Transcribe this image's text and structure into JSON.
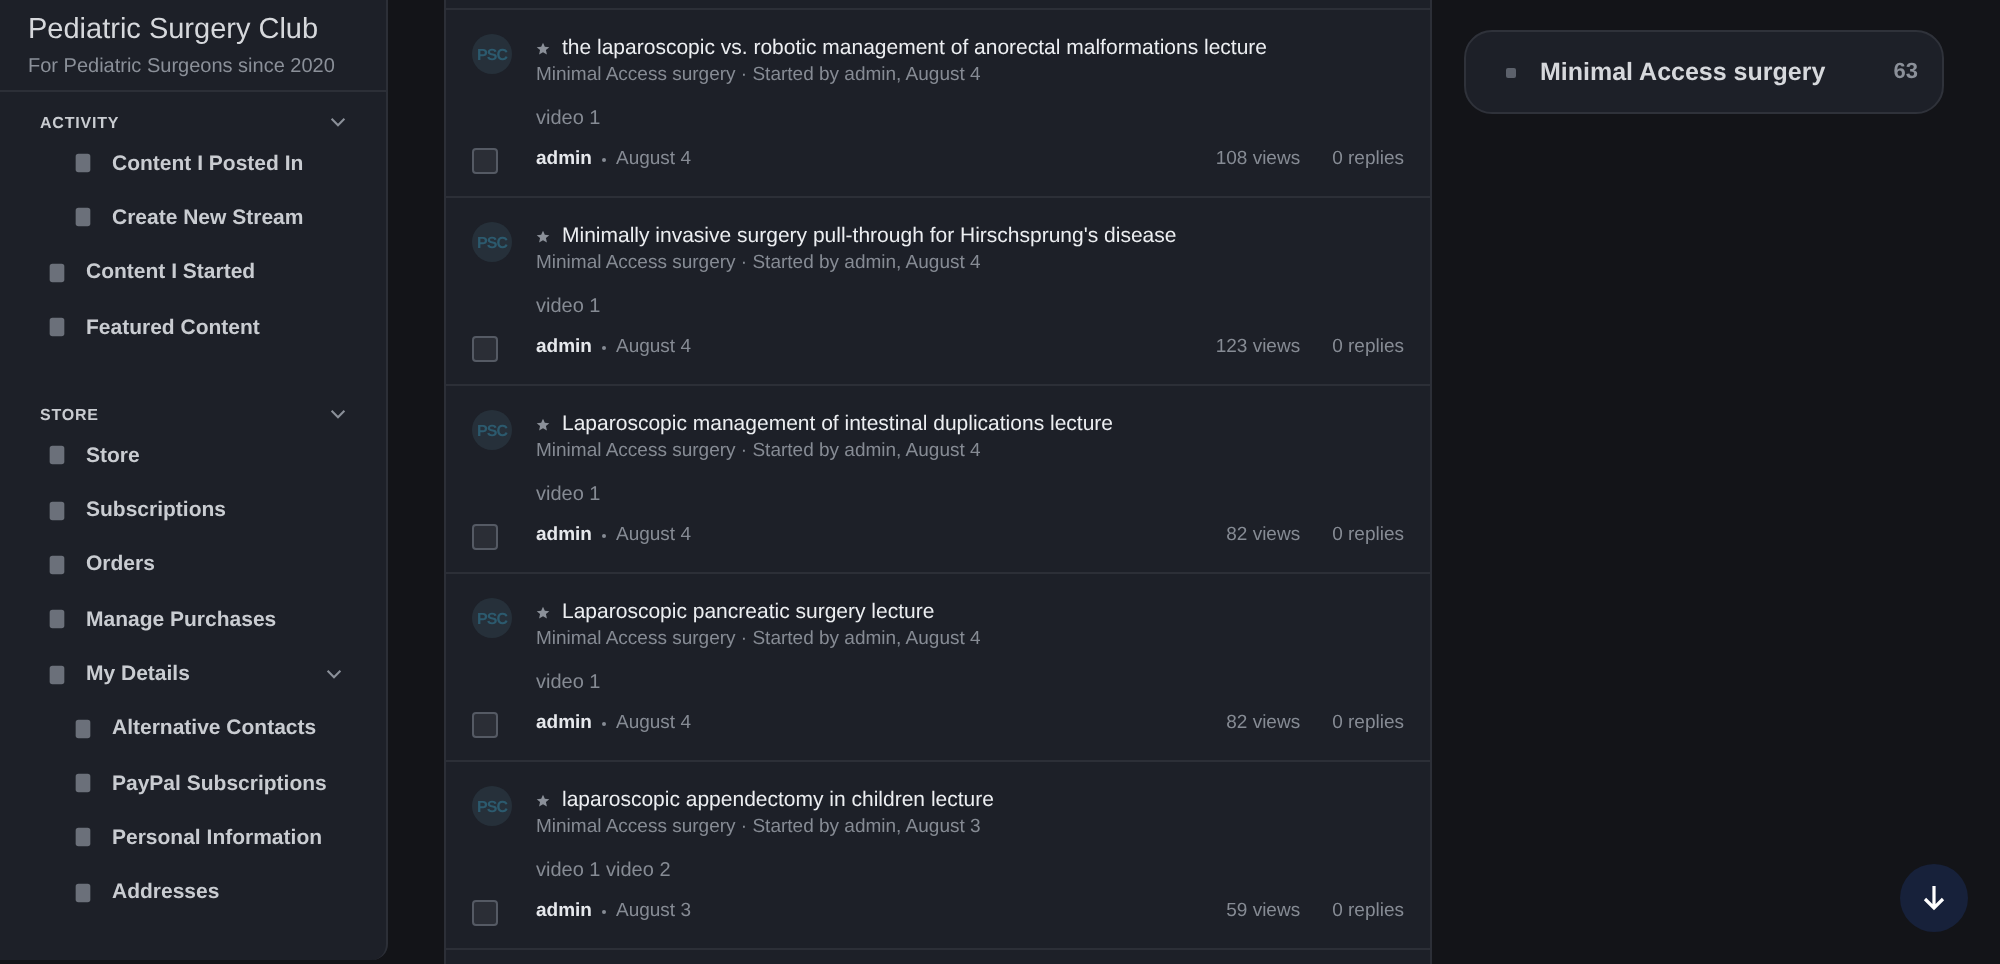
{
  "sidebar": {
    "title": "Pediatric Surgery Club",
    "subtitle": "For Pediatric Surgeons since 2020",
    "sections": [
      {
        "label": "ACTIVITY",
        "expanded": true,
        "items": [
          {
            "label": "Content I Posted In",
            "kind": "sub"
          },
          {
            "label": "Create New Stream",
            "kind": "sub"
          },
          {
            "label": "Content I Started",
            "kind": "item"
          },
          {
            "label": "Featured Content",
            "kind": "item"
          }
        ]
      },
      {
        "label": "STORE",
        "expanded": true,
        "items": [
          {
            "label": "Store",
            "kind": "item"
          },
          {
            "label": "Subscriptions",
            "kind": "item"
          },
          {
            "label": "Orders",
            "kind": "item"
          },
          {
            "label": "Manage Purchases",
            "kind": "item"
          },
          {
            "label": "My Details",
            "kind": "item",
            "expanded": true,
            "children": [
              {
                "label": "Alternative Contacts",
                "kind": "sub"
              },
              {
                "label": "PayPal Subscriptions",
                "kind": "sub"
              },
              {
                "label": "Personal Information",
                "kind": "sub"
              },
              {
                "label": "Addresses",
                "kind": "sub"
              }
            ]
          }
        ]
      }
    ]
  },
  "topics": [
    {
      "avatar": "PSC",
      "title": "the laparoscopic vs. robotic management of anorectal malformations lecture",
      "meta": "Minimal Access surgery · Started by admin, August 4",
      "body": "video 1",
      "author": "admin",
      "date": "August 4",
      "views": "108 views",
      "replies": "0 replies",
      "checked": false
    },
    {
      "avatar": "PSC",
      "title": "Minimally invasive surgery pull-through for Hirschsprung's disease",
      "meta": "Minimal Access surgery · Started by admin, August 4",
      "body": "video 1",
      "author": "admin",
      "date": "August 4",
      "views": "123 views",
      "replies": "0 replies",
      "checked": false
    },
    {
      "avatar": "PSC",
      "title": "Laparoscopic management of intestinal duplications lecture",
      "meta": "Minimal Access surgery · Started by admin, August 4",
      "body": "video 1",
      "author": "admin",
      "date": "August 4",
      "views": "82 views",
      "replies": "0 replies",
      "checked": false
    },
    {
      "avatar": "PSC",
      "title": "Laparoscopic pancreatic surgery lecture",
      "meta": "Minimal Access surgery · Started by admin, August 4",
      "body": "video 1",
      "author": "admin",
      "date": "August 4",
      "views": "82 views",
      "replies": "0 replies",
      "checked": false
    },
    {
      "avatar": "PSC",
      "title": "laparoscopic appendectomy in children lecture",
      "meta": "Minimal Access surgery · Started by admin, August 3",
      "body": "video 1 video 2",
      "author": "admin",
      "date": "August 3",
      "views": "59 views",
      "replies": "0 replies",
      "checked": false
    }
  ],
  "category": {
    "label": "Minimal Access surgery",
    "count": "63"
  }
}
